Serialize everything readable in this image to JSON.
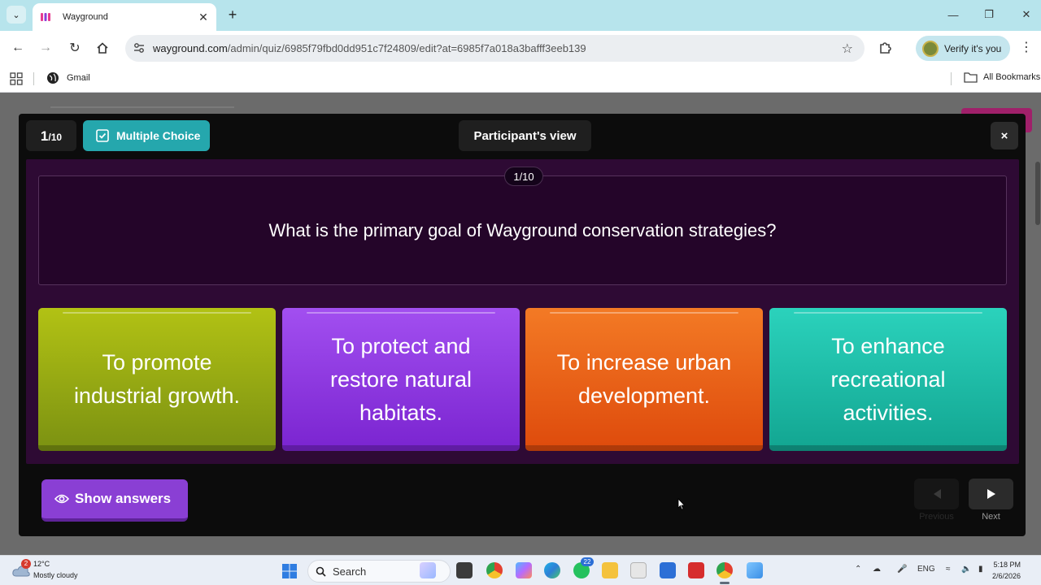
{
  "browser": {
    "tab_title": "Wayground",
    "url_host": "wayground.com",
    "url_path": "/admin/quiz/6985f79fbd0dd951c7f24809/edit?at=6985f7a018a3bafff3eeb139",
    "profile_label": "Verify it's you",
    "bookmarks": [
      {
        "label": "Gmail"
      }
    ],
    "all_bookmarks_label": "All Bookmarks"
  },
  "modal": {
    "counter_current": "1",
    "counter_total": "/10",
    "question_type": "Multiple Choice",
    "view_label": "Participant's view",
    "close_label": "×",
    "question_badge": "1/10",
    "question": "What is the primary goal of Wayground conservation strategies?",
    "options": [
      {
        "text": "To promote industrial growth.",
        "color": "#a0b212"
      },
      {
        "text": "To protect and restore natural habitats.",
        "color": "#8e3ae2"
      },
      {
        "text": "To increase urban development.",
        "color": "#e8621a"
      },
      {
        "text": "To enhance recreational activities.",
        "color": "#1fbca6"
      }
    ],
    "show_answers_label": "Show answers",
    "previous_label": "Previous",
    "next_label": "Next"
  },
  "taskbar": {
    "weather_badge": "2",
    "temperature": "12°C",
    "condition": "Mostly cloudy",
    "search_label": "Search",
    "whatsapp_badge": "22",
    "language": "ENG",
    "time": "5:18 PM",
    "date": "2/6/2026"
  }
}
